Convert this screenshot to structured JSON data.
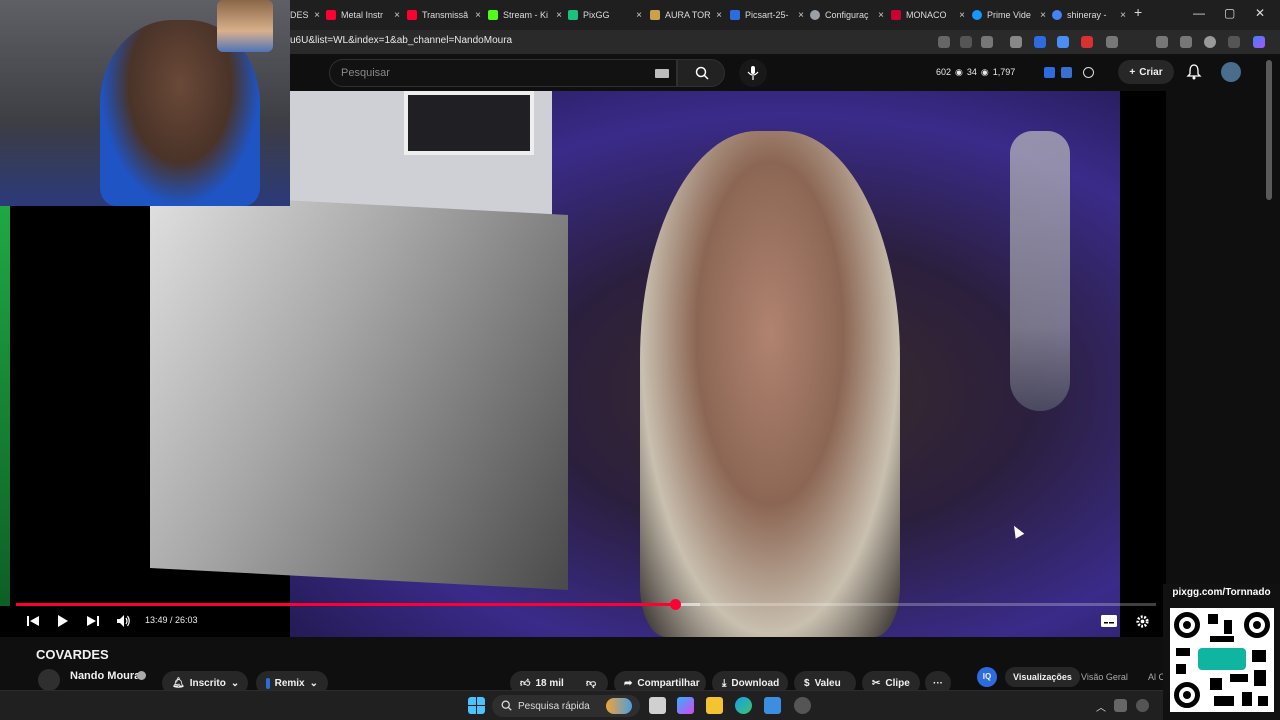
{
  "browser": {
    "tabs": [
      {
        "label": "DES",
        "fav": "#7a7a7a"
      },
      {
        "label": "Metal Instr",
        "fav": "#ff0033"
      },
      {
        "label": "Transmissã",
        "fav": "#ff0033"
      },
      {
        "label": "Stream - Ki",
        "fav": "#53fc18"
      },
      {
        "label": "PixGG",
        "fav": "#19c37d"
      },
      {
        "label": "AURA TORI",
        "fav": "#caa24b"
      },
      {
        "label": "Picsart-25-",
        "fav": "#2d6cdf"
      },
      {
        "label": "Configuraç",
        "fav": "#9aa0a6"
      },
      {
        "label": "MONACO",
        "fav": "#cc0033"
      },
      {
        "label": "Prime Vide",
        "fav": "#1399ff"
      },
      {
        "label": "shineray -",
        "fav": "#4285f4"
      }
    ],
    "tab_close": "×",
    "new_tab": "+",
    "minimize": "—",
    "maximize": "▢",
    "close": "✕",
    "url": "u6U&list=WL&index=1&ab_channel=NandoMoura"
  },
  "header": {
    "search_placeholder": "Pesquisar",
    "stat_views": "602",
    "stat_a": "34",
    "stat_b": "1,797",
    "create_label": "Criar"
  },
  "player": {
    "time": "13:49 / 26:03",
    "progress": 0.578,
    "buffered": 0.6
  },
  "video": {
    "title": "COVARDES",
    "channel": "Nando Moura",
    "subscribe_label": "Inscrito",
    "remix_label": "Remix",
    "likes": "18 mil",
    "share_label": "Compartilhar",
    "download_label": "Download",
    "valeu_label": "Valeu",
    "clip_label": "Clipe",
    "more": "···",
    "iq_tabs": [
      "Visualizações",
      "Visão Geral",
      "Al C"
    ]
  },
  "taskbar": {
    "search_label": "Pesquisa rápida"
  },
  "overlay": {
    "qr_label": "pixgg.com/Tornnado"
  },
  "icons": {
    "search": "search-icon",
    "mic": "microphone-icon",
    "bell": "notification-bell-icon"
  }
}
